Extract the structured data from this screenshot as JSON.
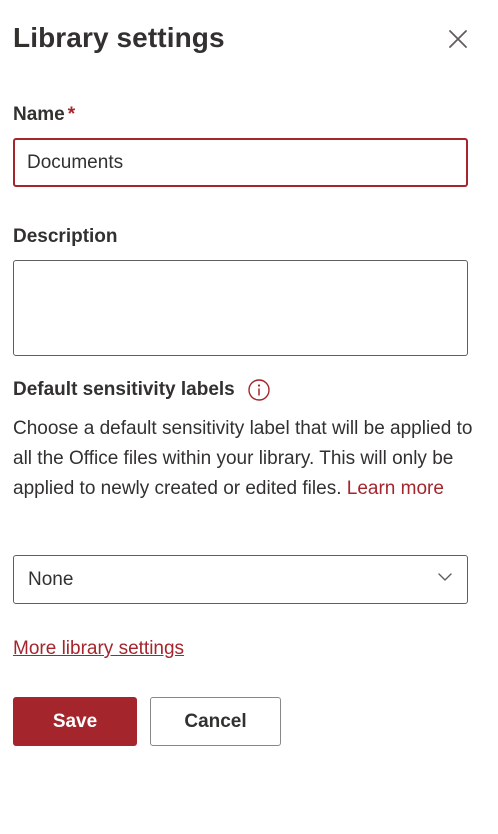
{
  "panel": {
    "title": "Library settings",
    "close_icon": "close-icon"
  },
  "name_field": {
    "label": "Name",
    "required_marker": "*",
    "value": "Documents"
  },
  "description_field": {
    "label": "Description",
    "value": ""
  },
  "sensitivity": {
    "label": "Default sensitivity labels",
    "info_icon": "info-icon",
    "help_text": "Choose a default sensitivity label that will be applied to all the Office files within your library. This will only be applied to newly created or edited files.",
    "learn_more": "Learn more",
    "selected_value": "None",
    "dropdown_icon": "chevron-down-icon"
  },
  "links": {
    "more_settings": "More library settings"
  },
  "buttons": {
    "save": "Save",
    "cancel": "Cancel"
  },
  "colors": {
    "accent": "#a4262c",
    "text": "#323130",
    "border": "#605e5c"
  }
}
